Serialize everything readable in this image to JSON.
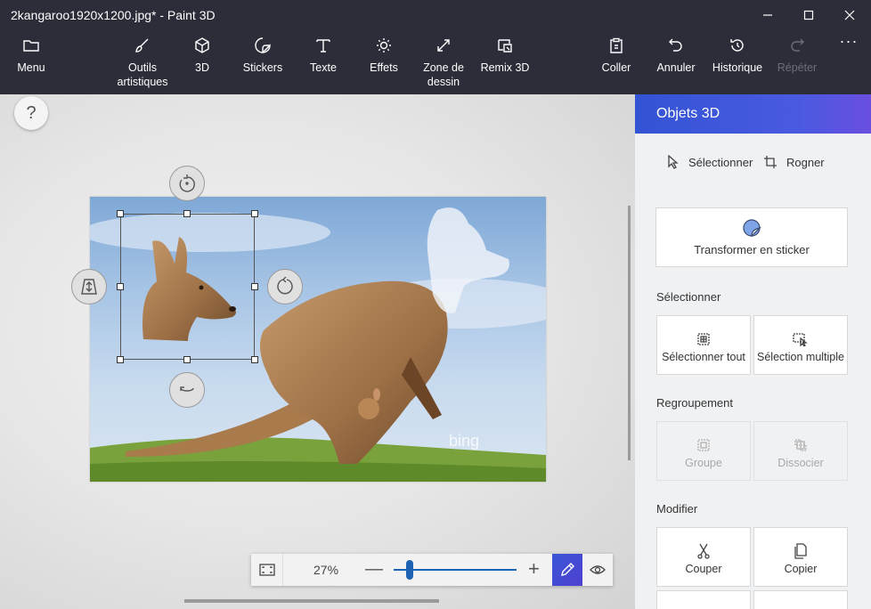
{
  "window": {
    "title": "2kangaroo1920x1200.jpg* - Paint 3D"
  },
  "toolbar": {
    "items": [
      {
        "label": "Menu",
        "icon": "folder-icon"
      },
      {
        "label": "Outils\nartistiques",
        "icon": "brush-icon"
      },
      {
        "label": "3D",
        "icon": "cube-icon"
      },
      {
        "label": "Stickers",
        "icon": "sticker-icon"
      },
      {
        "label": "Texte",
        "icon": "text-icon"
      },
      {
        "label": "Effets",
        "icon": "sun-icon"
      },
      {
        "label": "Zone de\ndessin",
        "icon": "canvas-resize-icon"
      },
      {
        "label": "Remix 3D",
        "icon": "remix-icon"
      },
      {
        "label": "Coller",
        "icon": "paste-icon"
      },
      {
        "label": "Annuler",
        "icon": "undo-icon"
      },
      {
        "label": "Historique",
        "icon": "history-icon"
      },
      {
        "label": "Répéter",
        "icon": "redo-icon",
        "disabled": true
      }
    ],
    "more": "···"
  },
  "canvas": {
    "help": "?",
    "watermark": "bing"
  },
  "zoom": {
    "percent": "27%",
    "level": 0.13,
    "minus": "—",
    "plus": "+"
  },
  "panel": {
    "title": "Objets 3D",
    "modes": {
      "select": "Sélectionner",
      "crop": "Rogner"
    },
    "make_sticker": "Transformer en sticker",
    "sections": {
      "select": {
        "heading": "Sélectionner",
        "select_all": "Sélectionner tout",
        "multi_select": "Sélection multiple"
      },
      "group": {
        "heading": "Regroupement",
        "group": "Groupe",
        "ungroup": "Dissocier"
      },
      "edit": {
        "heading": "Modifier",
        "cut": "Couper",
        "copy": "Copier"
      }
    }
  },
  "colors": {
    "chrome": "#2b2d38",
    "accent": "#3354d4",
    "panel_bg": "#f0f1f3"
  }
}
